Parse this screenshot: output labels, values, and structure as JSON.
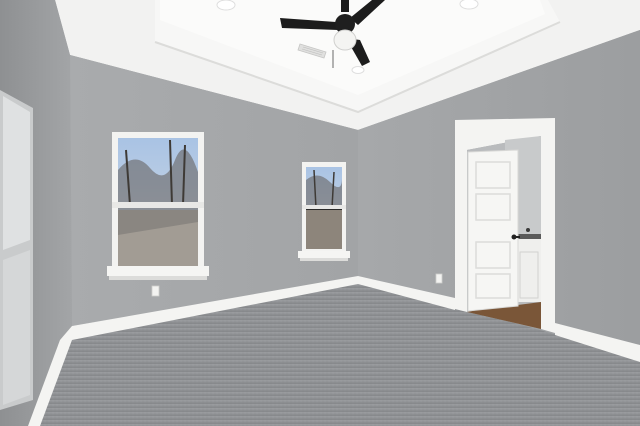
{
  "scene": {
    "description_colors": {
      "wall": "#a4a6a8",
      "wall_light": "#b4b6b8",
      "ceiling": "#f1f1f0",
      "carpet": "#8f9194",
      "trim": "#f4f4f2",
      "floor_wood": "#7a5638",
      "fan_black": "#1c1c1c",
      "sky": "#b8cde6"
    },
    "icons": [
      "ceiling-fan-icon",
      "recessed-light-icon",
      "air-vent-icon",
      "outlet-icon",
      "door-handle-icon"
    ]
  }
}
